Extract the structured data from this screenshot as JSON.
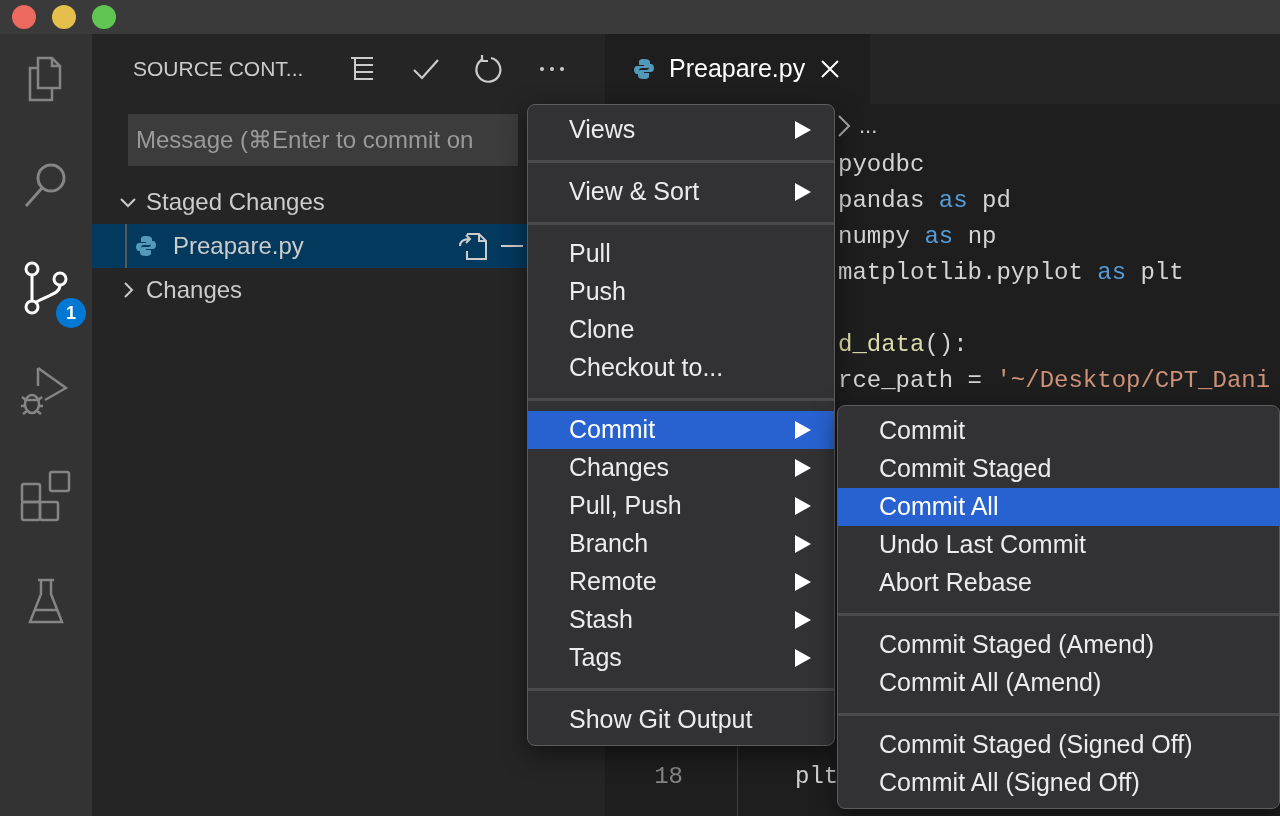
{
  "activity_bar": {
    "items": [
      {
        "kind": "files",
        "selected": false
      },
      {
        "kind": "search",
        "selected": false
      },
      {
        "kind": "source-control",
        "selected": true,
        "badge": "1"
      },
      {
        "kind": "debug",
        "selected": false
      },
      {
        "kind": "extensions",
        "selected": false
      },
      {
        "kind": "testing",
        "selected": false
      }
    ]
  },
  "sidebar": {
    "title": "SOURCE CONT...",
    "message": {
      "placeholder": "Message (⌘Enter to commit on"
    },
    "groups": [
      {
        "label": "Staged Changes",
        "expanded": true,
        "files": [
          {
            "name": "Preapare.py",
            "selected": true
          }
        ]
      },
      {
        "label": "Changes",
        "expanded": false
      }
    ]
  },
  "editor": {
    "tabs": [
      {
        "label": "Preapare.py",
        "selected": true
      }
    ],
    "breadcrumb": "...",
    "top_blocks": [
      [
        {
          "tokens": [
            {
              "kind": "plain",
              "text": "pyodbc"
            }
          ]
        },
        {
          "tokens": [
            {
              "kind": "plain",
              "text": "pandas "
            },
            {
              "kind": "keyword",
              "text": "as"
            },
            {
              "kind": "plain",
              "text": " pd"
            }
          ]
        },
        {
          "tokens": [
            {
              "kind": "plain",
              "text": "numpy "
            },
            {
              "kind": "keyword",
              "text": "as"
            },
            {
              "kind": "plain",
              "text": " np"
            }
          ]
        },
        {
          "tokens": [
            {
              "kind": "plain",
              "text": "matplotlib.pyplot "
            },
            {
              "kind": "keyword",
              "text": "as"
            },
            {
              "kind": "plain",
              "text": " plt"
            }
          ]
        }
      ],
      [
        {
          "tokens": [
            {
              "kind": "function",
              "text": "d_data"
            },
            {
              "kind": "plain",
              "text": "():"
            }
          ]
        },
        {
          "tokens": [
            {
              "kind": "plain",
              "text": "rce_path = "
            },
            {
              "kind": "string",
              "text": "'~/Desktop/CPT_Dani"
            }
          ]
        }
      ]
    ],
    "bottom_lines": [
      {
        "number": "18",
        "tokens": [
          {
            "kind": "plain",
            "text": "plt"
          }
        ]
      }
    ]
  },
  "context_menu": {
    "groups": [
      [
        {
          "label": "Views",
          "submenu": true,
          "selected": false
        }
      ],
      [
        {
          "label": "View & Sort",
          "submenu": true,
          "selected": false
        }
      ],
      [
        {
          "label": "Pull",
          "submenu": false,
          "selected": false
        },
        {
          "label": "Push",
          "submenu": false,
          "selected": false
        },
        {
          "label": "Clone",
          "submenu": false,
          "selected": false
        },
        {
          "label": "Checkout to...",
          "submenu": false,
          "selected": false
        }
      ],
      [
        {
          "label": "Commit",
          "submenu": true,
          "selected": true
        },
        {
          "label": "Changes",
          "submenu": true,
          "selected": false
        },
        {
          "label": "Pull, Push",
          "submenu": true,
          "selected": false
        },
        {
          "label": "Branch",
          "submenu": true,
          "selected": false
        },
        {
          "label": "Remote",
          "submenu": true,
          "selected": false
        },
        {
          "label": "Stash",
          "submenu": true,
          "selected": false
        },
        {
          "label": "Tags",
          "submenu": true,
          "selected": false
        }
      ],
      [
        {
          "label": "Show Git Output",
          "submenu": false,
          "selected": false
        }
      ]
    ]
  },
  "submenu": {
    "groups": [
      [
        {
          "label": "Commit",
          "submenu": false,
          "selected": false
        },
        {
          "label": "Commit Staged",
          "submenu": false,
          "selected": false
        },
        {
          "label": "Commit All",
          "submenu": false,
          "selected": true
        },
        {
          "label": "Undo Last Commit",
          "submenu": false,
          "selected": false
        },
        {
          "label": "Abort Rebase",
          "submenu": false,
          "selected": false
        }
      ],
      [
        {
          "label": "Commit Staged (Amend)",
          "submenu": false,
          "selected": false
        },
        {
          "label": "Commit All (Amend)",
          "submenu": false,
          "selected": false
        }
      ],
      [
        {
          "label": "Commit Staged (Signed Off)",
          "submenu": false,
          "selected": false
        },
        {
          "label": "Commit All (Signed Off)",
          "submenu": false,
          "selected": false
        }
      ]
    ]
  }
}
